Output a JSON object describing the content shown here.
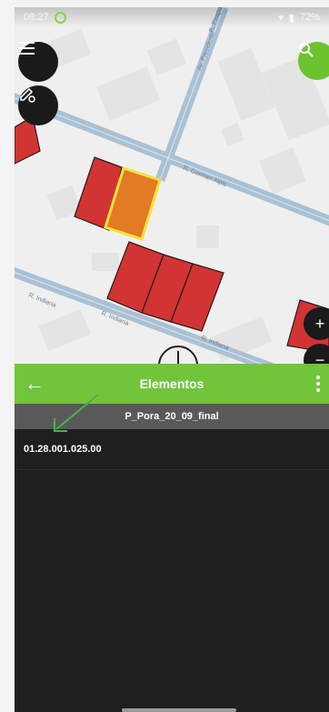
{
  "status_bar": {
    "time": "08:27",
    "battery": "72%"
  },
  "map": {
    "streets": [
      "R. German Alpis",
      "Av. Presidente",
      "R. Indiana",
      "R. Indiana",
      "R. Indiana",
      "R. Pirapu"
    ],
    "icons": {
      "menu": "menu-icon",
      "settings": "edit-settings-icon",
      "search": "search-icon",
      "zoom_in": "plus-icon",
      "zoom_out": "minus-icon"
    }
  },
  "panel": {
    "title": "Elementos",
    "layer_name": "P_Pora_20_09_final",
    "items": [
      {
        "label": "01.28.001.025.00"
      }
    ]
  },
  "colors": {
    "accent": "#72c43b",
    "parcel": "#d23434",
    "selected_parcel": "#e37a24",
    "selection_outline": "#f1e23a",
    "panel_bg": "#1f1f22"
  }
}
